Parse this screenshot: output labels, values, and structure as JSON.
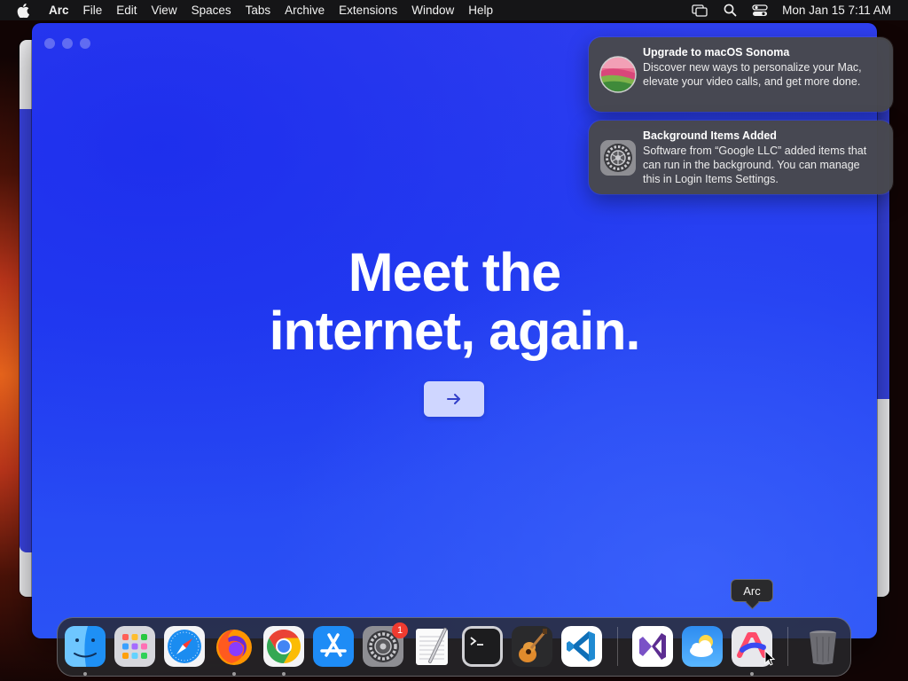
{
  "menubar": {
    "app_name": "Arc",
    "menus": [
      "File",
      "Edit",
      "View",
      "Spaces",
      "Tabs",
      "Archive",
      "Extensions",
      "Window",
      "Help"
    ],
    "clock": "Mon Jan 15  7:11 AM",
    "status_icons": [
      "screen-mirroring-icon",
      "spotlight-search-icon",
      "control-center-icon"
    ]
  },
  "arc_window": {
    "headline_line1": "Meet the",
    "headline_line2": "internet, again.",
    "next_button_icon": "arrow-right-icon",
    "accent_color": "#2a44f2"
  },
  "notifications": [
    {
      "title": "Upgrade to macOS Sonoma",
      "body": "Discover new ways to personalize your Mac, elevate your video calls, and get more done.",
      "icon": "macos-sonoma-icon"
    },
    {
      "title": "Background Items Added",
      "body": "Software from “Google LLC” added items that can run in the background. You can manage this in Login Items Settings.",
      "icon": "system-settings-gear-icon"
    }
  ],
  "dock": {
    "tooltip": "Arc",
    "settings_badge": "1",
    "apps": [
      "Finder",
      "Launchpad",
      "Safari",
      "Firefox",
      "Google Chrome",
      "App Store",
      "System Settings",
      "TextEdit",
      "Terminal",
      "GarageBand",
      "Visual Studio Code",
      "Visual Studio",
      "Weather",
      "Arc",
      "Trash"
    ]
  }
}
